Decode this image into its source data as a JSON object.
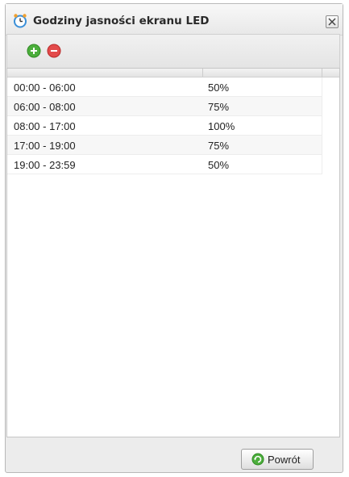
{
  "window": {
    "title": "Godziny jasności ekranu LED",
    "title_icon": "clock-icon",
    "close_icon": "close-icon"
  },
  "toolbar": {
    "add_icon": "add-icon",
    "remove_icon": "remove-icon"
  },
  "schedule": {
    "rows": [
      {
        "time": "00:00 - 06:00",
        "brightness": "50%"
      },
      {
        "time": "06:00 - 08:00",
        "brightness": "75%"
      },
      {
        "time": "08:00 - 17:00",
        "brightness": "100%"
      },
      {
        "time": "17:00 - 19:00",
        "brightness": "75%"
      },
      {
        "time": "19:00 - 23:59",
        "brightness": "50%"
      }
    ]
  },
  "footer": {
    "back_label": "Powrót",
    "back_icon": "refresh-icon"
  },
  "colors": {
    "add_green": "#4cae3c",
    "remove_red": "#e34b4b",
    "clock_blue": "#3a8fd8"
  }
}
